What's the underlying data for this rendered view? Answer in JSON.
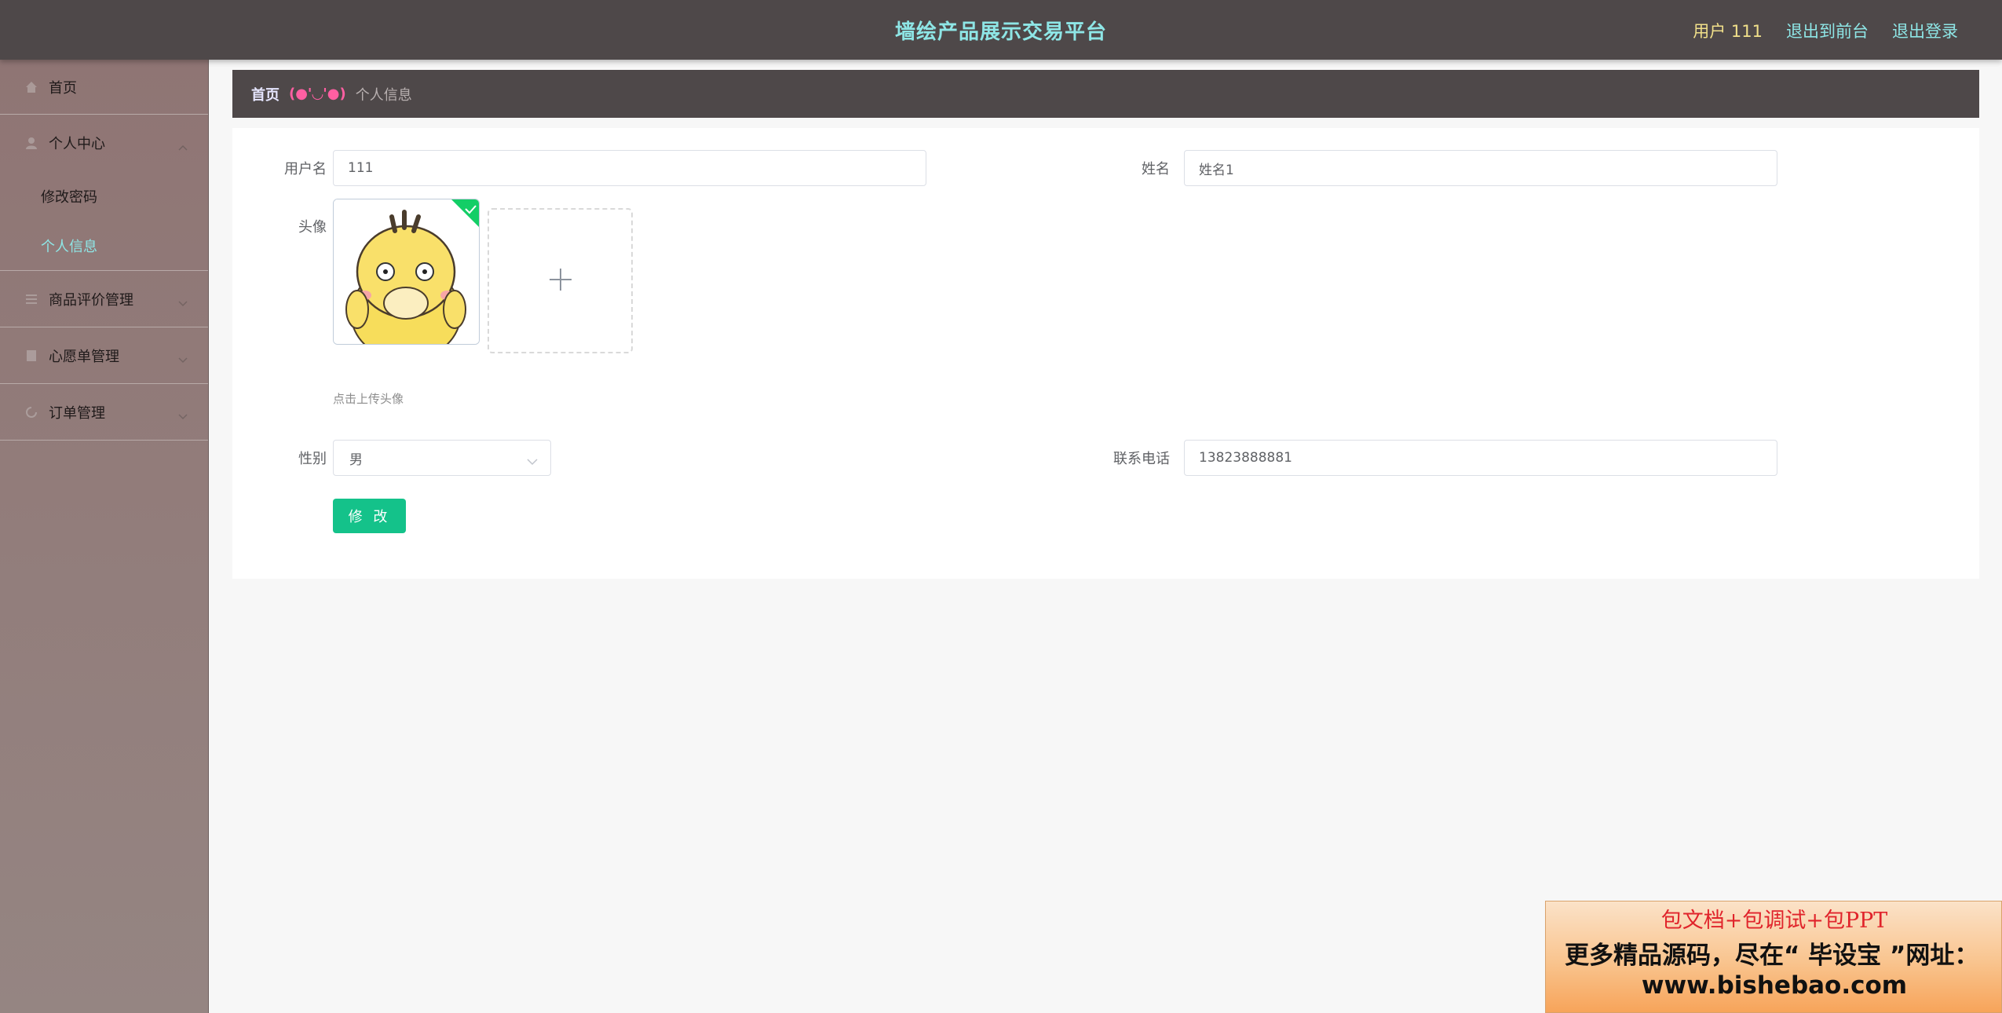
{
  "header": {
    "title": "墙绘产品展示交易平台",
    "user_label": "用户 111",
    "exit_front": "退出到前台",
    "logout": "退出登录"
  },
  "sidebar": {
    "home": "首页",
    "personal_center": "个人中心",
    "change_password": "修改密码",
    "personal_info": "个人信息",
    "review_mgmt": "商品评价管理",
    "wishlist_mgmt": "心愿单管理",
    "order_mgmt": "订单管理"
  },
  "breadcrumb": {
    "home": "首页",
    "separator": "(●'◡'●)",
    "current": "个人信息"
  },
  "form": {
    "username_label": "用户名",
    "username_value": "111",
    "name_label": "姓名",
    "name_value": "姓名1",
    "avatar_label": "头像",
    "avatar_hint": "点击上传头像",
    "gender_label": "性别",
    "gender_value": "男",
    "phone_label": "联系电话",
    "phone_value": "13823888881",
    "submit": "修 改"
  },
  "ad": {
    "line1": "包文档+包调试+包PPT",
    "line2": "更多精品源码，尽在“ 毕设宝 ”网址：",
    "line3": "www.bishebao.com"
  },
  "colors": {
    "header_bg": "#4e4849",
    "title": "#8ee6e6",
    "user": "#f1e08a",
    "accent_button": "#14c28a"
  }
}
